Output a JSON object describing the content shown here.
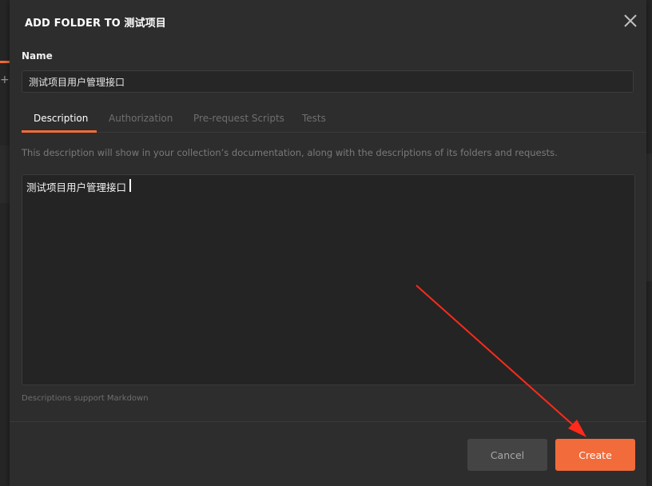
{
  "dialog": {
    "title": "ADD FOLDER TO 测试项目",
    "name_label": "Name",
    "name_value": "测试项目用户管理接口",
    "tabs": [
      {
        "label": "Description",
        "active": true
      },
      {
        "label": "Authorization",
        "active": false
      },
      {
        "label": "Pre-request Scripts",
        "active": false
      },
      {
        "label": "Tests",
        "active": false
      }
    ],
    "description_hint": "This description will show in your collection’s documentation, along with the descriptions of its folders and requests.",
    "description_value": "测试项目用户管理接口",
    "markdown_hint": "Descriptions support Markdown",
    "cancel_label": "Cancel",
    "create_label": "Create"
  },
  "icons": {
    "close": "close-icon",
    "background_add": "plus-icon"
  },
  "colors": {
    "accent": "#f26b3a",
    "modal_bg": "#2d2d2d",
    "annotation_arrow": "#ff2a1a"
  }
}
